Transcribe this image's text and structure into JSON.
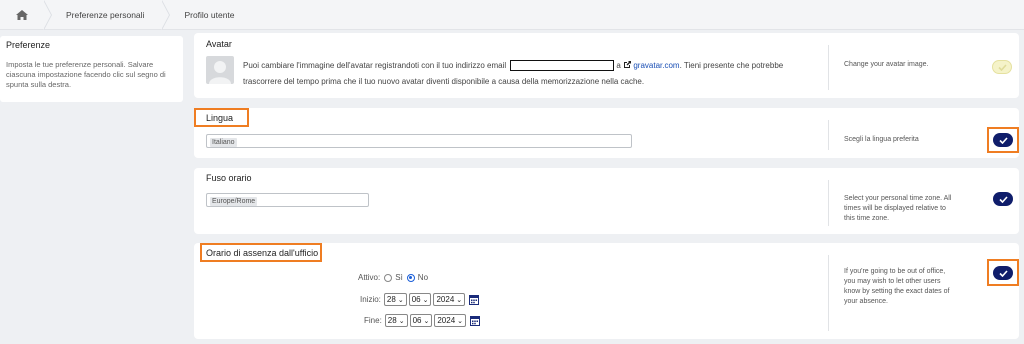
{
  "breadcrumb": {
    "items": [
      "Preferenze personali",
      "Profilo utente"
    ]
  },
  "sidebar": {
    "title": "Preferenze",
    "description": "Imposta le tue preferenze personali. Salvare ciascuna impostazione facendo clic sul segno di spunta sulla destra."
  },
  "avatar": {
    "title": "Avatar",
    "text_part1": "Puoi cambiare l'immagine dell'avatar registrandoti con il tuo indirizzo email",
    "text_a": "a",
    "link": "gravatar.com",
    "text_part2": ". Tieni presente che potrebbe trascorrere del tempo prima che il tuo nuovo avatar diventi disponibile a causa della memorizzazione nella cache.",
    "help": "Change your avatar image."
  },
  "language": {
    "title": "Lingua",
    "value": "Italiano",
    "help": "Scegli la lingua preferita"
  },
  "timezone": {
    "title": "Fuso orario",
    "value": "Europe/Rome",
    "help": "Select your personal time zone. All times will be displayed relative to this time zone."
  },
  "out_of_office": {
    "title": "Orario di assenza dall'ufficio",
    "active_label": "Attivo:",
    "yes_label": "Sì",
    "no_label": "No",
    "start_label": "Inizio:",
    "end_label": "Fine:",
    "start": {
      "day": "28",
      "month": "06",
      "year": "2024"
    },
    "end": {
      "day": "28",
      "month": "06",
      "year": "2024"
    },
    "help": "If you're going to be out of office, you may wish to let other users know by setting the exact dates of your absence."
  },
  "colors": {
    "accent": "#0f1d6b",
    "highlight": "#ef7d22",
    "link": "#1a4fb5"
  }
}
